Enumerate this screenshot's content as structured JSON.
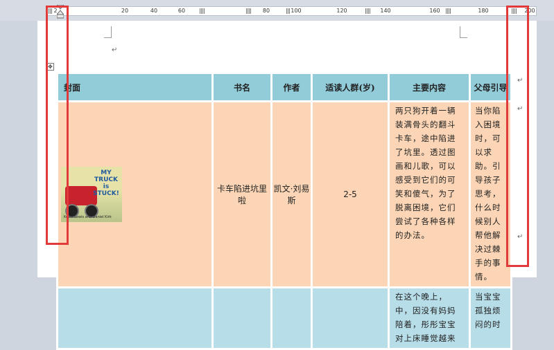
{
  "ruler": {
    "labels": [
      "2",
      "20",
      "40",
      "60",
      "80",
      "100",
      "120",
      "140",
      "160",
      "180",
      "200"
    ]
  },
  "table": {
    "headers": [
      "封面",
      "书名",
      "作者",
      "适读人群(岁)",
      "主要内容",
      "父母引导"
    ],
    "row1": {
      "cover": {
        "title_line1": "MY",
        "title_line2": "TRUCK is",
        "title_line3": "STUCK!",
        "authors": "Kevin Lewis and Daniel Kirk"
      },
      "book_name": "卡车陷进坑里啦",
      "author": "凯文·刘易斯",
      "age": "2-5",
      "content": "两只狗开着一辆装满骨头的翻斗卡车，途中陷进了坑里。透过图画和儿歌，可以感受到它们的可笑和傻气，为了脱离困境，它们尝试了各种各样的办法。",
      "parent_guide": "当你陷入困境时，可以求助。引导孩子思考，什么时候别人帮他解决过棘手的事情。"
    },
    "row2": {
      "content": "在这个晚上，中，因没有妈妈陪着，彤彤宝宝对上床睡觉越来",
      "parent_guide": "当宝宝孤独烦闷的时"
    }
  },
  "symbols": {
    "paragraph_mark": "↵",
    "cell_mark": "↵",
    "move_handle": "✥"
  },
  "colors": {
    "header_bg": "#92ccd9",
    "row1_bg": "#fbd5b5",
    "row2_bg": "#b7dde8",
    "highlight_box": "#e03a3a"
  }
}
